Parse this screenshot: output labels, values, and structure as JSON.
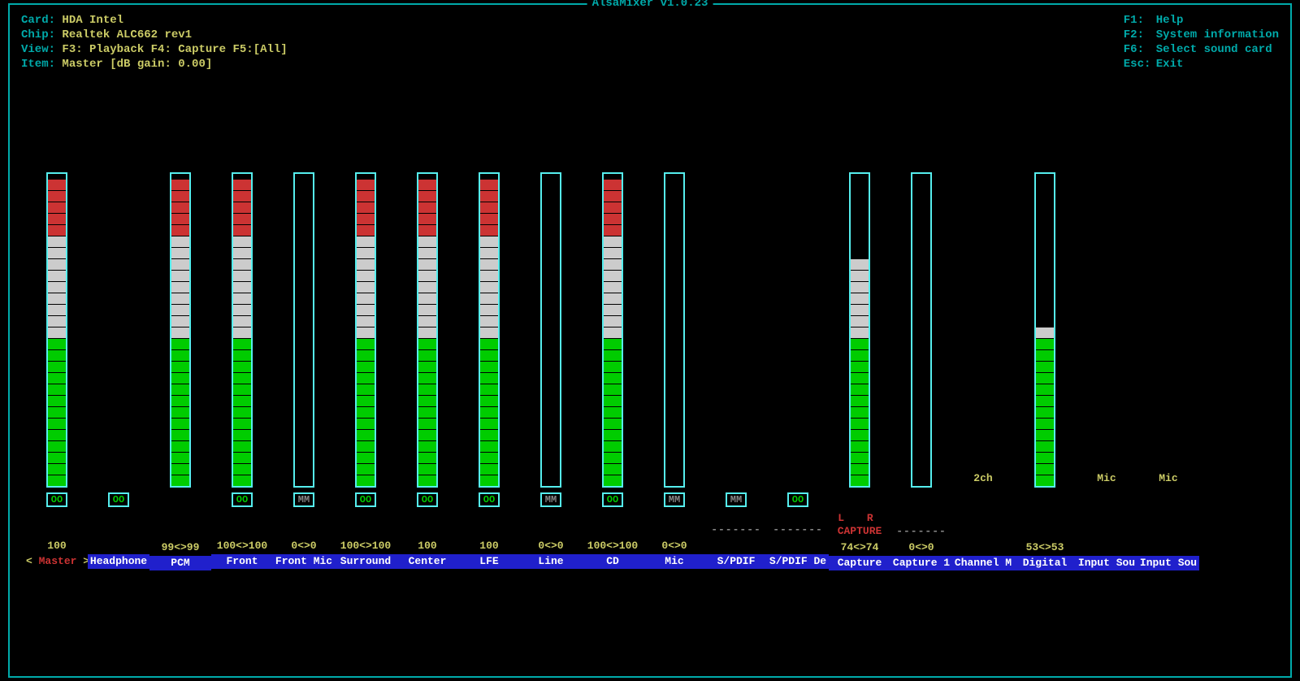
{
  "title": "AlsaMixer v1.0.23",
  "info": {
    "card_label": "Card:",
    "card_value": "HDA Intel",
    "chip_label": "Chip:",
    "chip_value": "Realtek ALC662 rev1",
    "view_label": "View:",
    "view_f3": "F3: Playback",
    "view_f4": "F4: Capture",
    "view_f5": "F5:",
    "view_all": "[All]",
    "item_label": "Item:",
    "item_value": "Master [dB gain: 0.00]"
  },
  "help": {
    "f1": "F1:",
    "f1d": "Help",
    "f2": "F2:",
    "f2d": "System information",
    "f6": "F6:",
    "f6d": "Select sound card",
    "esc": "Esc:",
    "escd": "Exit"
  },
  "channels": [
    {
      "name": "Master",
      "level": 100,
      "mute": "OO",
      "value": "100",
      "selected": true
    },
    {
      "name": "Headphone",
      "level": null,
      "mute": "OO",
      "value": ""
    },
    {
      "name": "PCM",
      "level": 99,
      "mute": null,
      "value": "99<>99"
    },
    {
      "name": "Front",
      "level": 100,
      "mute": "OO",
      "value": "100<>100"
    },
    {
      "name": "Front Mic",
      "level": 0,
      "mute": "MM",
      "value": "0<>0"
    },
    {
      "name": "Surround",
      "level": 100,
      "mute": "OO",
      "value": "100<>100"
    },
    {
      "name": "Center",
      "level": 100,
      "mute": "OO",
      "value": "100"
    },
    {
      "name": "LFE",
      "level": 100,
      "mute": "OO",
      "value": "100"
    },
    {
      "name": "Line",
      "level": 0,
      "mute": "MM",
      "value": "0<>0"
    },
    {
      "name": "CD",
      "level": 100,
      "mute": "OO",
      "value": "100<>100"
    },
    {
      "name": "Mic",
      "level": 0,
      "mute": "MM",
      "value": "0<>0"
    },
    {
      "name": "S/PDIF",
      "level": null,
      "mute": "MM",
      "value": "",
      "capture": "dashes"
    },
    {
      "name": "S/PDIF De",
      "level": null,
      "mute": "OO",
      "value": "",
      "capture": "dashes"
    },
    {
      "name": "Capture",
      "level": 74,
      "mute": null,
      "value": "74<>74",
      "capture": "lr"
    },
    {
      "name": "Capture 1",
      "level": 0,
      "mute": null,
      "value": "0<>0",
      "capture": "dashes"
    },
    {
      "name": "Channel M",
      "enum": "2ch"
    },
    {
      "name": "Digital",
      "level": 53,
      "mute": null,
      "value": "53<>53"
    },
    {
      "name": "Input Sou",
      "enum": "Mic"
    },
    {
      "name": "Input Sou",
      "enum": "Mic"
    }
  ],
  "capture_text": {
    "lr": "L R",
    "word": "CAPTURE",
    "dashes": "-------"
  }
}
